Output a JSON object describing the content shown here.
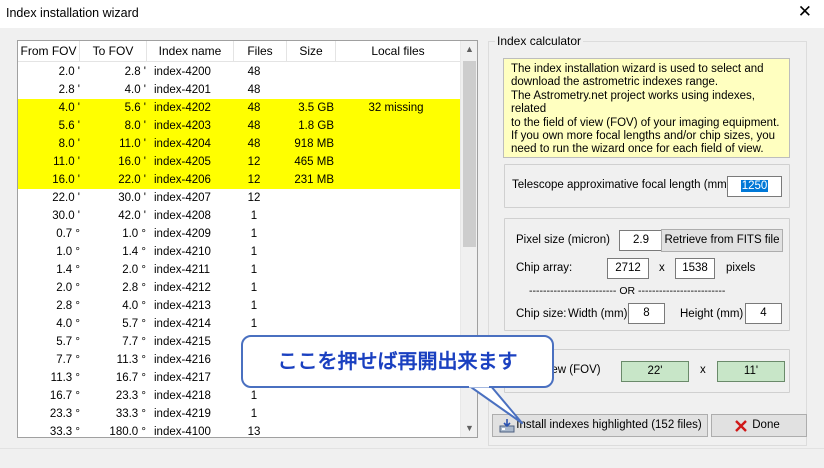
{
  "window": {
    "title": "Index installation wizard",
    "close_glyph": "✕"
  },
  "table": {
    "headers": [
      "From FOV",
      "To FOV",
      "Index name",
      "Files",
      "Size",
      "Local files"
    ],
    "rows": [
      {
        "from": "2.0 '",
        "to": "2.8 '",
        "name": "index-4200",
        "files": "48",
        "size": "",
        "local": "",
        "hl": false
      },
      {
        "from": "2.8 '",
        "to": "4.0 '",
        "name": "index-4201",
        "files": "48",
        "size": "",
        "local": "",
        "hl": false
      },
      {
        "from": "4.0 '",
        "to": "5.6 '",
        "name": "index-4202",
        "files": "48",
        "size": "3.5 GB",
        "local": "32 missing",
        "hl": true
      },
      {
        "from": "5.6 '",
        "to": "8.0 '",
        "name": "index-4203",
        "files": "48",
        "size": "1.8 GB",
        "local": "",
        "hl": true
      },
      {
        "from": "8.0 '",
        "to": "11.0 '",
        "name": "index-4204",
        "files": "48",
        "size": "918 MB",
        "local": "",
        "hl": true
      },
      {
        "from": "11.0 '",
        "to": "16.0 '",
        "name": "index-4205",
        "files": "12",
        "size": "465 MB",
        "local": "",
        "hl": true
      },
      {
        "from": "16.0 '",
        "to": "22.0 '",
        "name": "index-4206",
        "files": "12",
        "size": "231 MB",
        "local": "",
        "hl": true
      },
      {
        "from": "22.0 '",
        "to": "30.0 '",
        "name": "index-4207",
        "files": "12",
        "size": "",
        "local": "",
        "hl": false
      },
      {
        "from": "30.0 '",
        "to": "42.0 '",
        "name": "index-4208",
        "files": "1",
        "size": "",
        "local": "",
        "hl": false
      },
      {
        "from": "0.7 °",
        "to": "1.0 °",
        "name": "index-4209",
        "files": "1",
        "size": "",
        "local": "",
        "hl": false
      },
      {
        "from": "1.0 °",
        "to": "1.4 °",
        "name": "index-4210",
        "files": "1",
        "size": "",
        "local": "",
        "hl": false
      },
      {
        "from": "1.4 °",
        "to": "2.0 °",
        "name": "index-4211",
        "files": "1",
        "size": "",
        "local": "",
        "hl": false
      },
      {
        "from": "2.0 °",
        "to": "2.8 °",
        "name": "index-4212",
        "files": "1",
        "size": "",
        "local": "",
        "hl": false
      },
      {
        "from": "2.8 °",
        "to": "4.0 °",
        "name": "index-4213",
        "files": "1",
        "size": "",
        "local": "",
        "hl": false
      },
      {
        "from": "4.0 °",
        "to": "5.7 °",
        "name": "index-4214",
        "files": "1",
        "size": "",
        "local": "",
        "hl": false
      },
      {
        "from": "5.7 °",
        "to": "7.7 °",
        "name": "index-4215",
        "files": "",
        "size": "",
        "local": "",
        "hl": false
      },
      {
        "from": "7.7 °",
        "to": "11.3 °",
        "name": "index-4216",
        "files": "",
        "size": "",
        "local": "",
        "hl": false
      },
      {
        "from": "11.3 °",
        "to": "16.7 °",
        "name": "index-4217",
        "files": "",
        "size": "",
        "local": "",
        "hl": false
      },
      {
        "from": "16.7 °",
        "to": "23.3 °",
        "name": "index-4218",
        "files": "1",
        "size": "",
        "local": "",
        "hl": false
      },
      {
        "from": "23.3 °",
        "to": "33.3 °",
        "name": "index-4219",
        "files": "1",
        "size": "",
        "local": "",
        "hl": false
      },
      {
        "from": "33.3 °",
        "to": "180.0 °",
        "name": "index-4100",
        "files": "13",
        "size": "",
        "local": "",
        "hl": false
      }
    ]
  },
  "calculator": {
    "group_label": "Index calculator",
    "info_text": "The index installation wizard is used to select and\ndownload the astrometric indexes range.\nThe Astrometry.net project works using indexes, related\nto the field of view (FOV) of your imaging equipment.\nIf you own more focal lengths and/or chip sizes, you\nneed to run the wizard once for each field of view.",
    "focal_label": "Telescope approximative focal length (mm)",
    "focal_value": "1250",
    "pixel_size_label": "Pixel size (micron)",
    "pixel_size_value": "2.9",
    "retrieve_button": "Retrieve from FITS file",
    "chip_array_label": "Chip array:",
    "chip_array_w": "2712",
    "chip_array_x": "x",
    "chip_array_h": "1538",
    "chip_array_unit": "pixels",
    "or_separator": "------------------------- OR -------------------------",
    "chip_size_label": "Chip size:",
    "width_label": "Width (mm)",
    "width_value": "8",
    "height_label": "Height (mm)",
    "height_value": "4",
    "fov_label": "f View  (FOV)",
    "fov_w": "22'",
    "fov_x": "x",
    "fov_h": "11'"
  },
  "buttons": {
    "install": "Install indexes highlighted (152 files)",
    "done": "Done"
  },
  "callout": {
    "text": "ここを押せば再開出来ます"
  },
  "colors": {
    "highlight": "#ffff00",
    "info_bg": "#ffffc0",
    "fov_bg": "#c8e6c8",
    "callout_border": "#4a70c0",
    "callout_text": "#1a40c0"
  }
}
